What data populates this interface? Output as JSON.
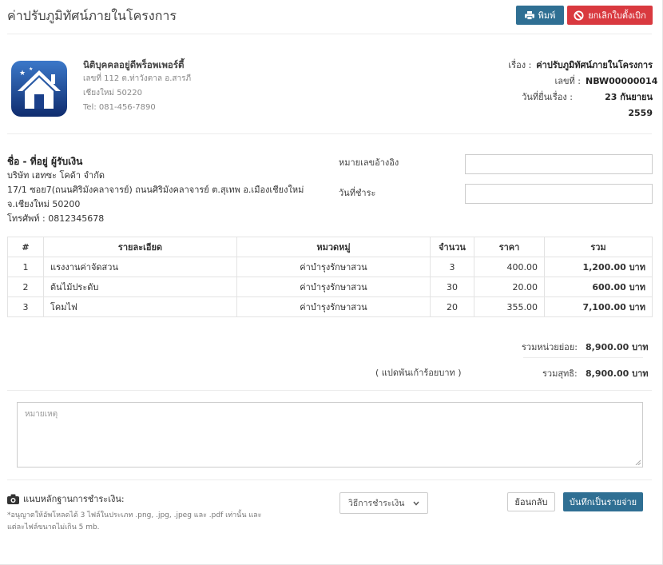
{
  "header": {
    "title": "ค่าปรับภูมิทัศน์ภายในโครงการ",
    "print_label": "พิมพ์",
    "cancel_label": "ยกเลิกใบตั้งเบิก"
  },
  "company": {
    "name": "นิติบุคคลอยู่ดีพร็อพเพอร์ตี้",
    "address1": "เลขที่ 112 ต.ท่าวังตาล อ.สารภี",
    "address2": "เชียงใหม่ 50220",
    "tel": "Tel: 081-456-7890"
  },
  "doc": {
    "subject_label": "เรื่อง :",
    "subject_value": "ค่าปรับภูมิทัศน์ภายในโครงการ",
    "number_label": "เลขที่ :",
    "number_value": "NBW00000014",
    "date_label": "วันที่ยื่นเรื่อง :",
    "date_value": "23 กันยายน 2559"
  },
  "payee": {
    "heading": "ชื่อ - ที่อยู่ ผู้รับเงิน",
    "name": "บริษัท เฮทซะ โคด้า จำกัด",
    "address1": "17/1 ซอย7(ถนนศิริมังคลาจารย์) ถนนศิริมังคลาจารย์ ต.สุเทพ อ.เมืองเชียงใหม่",
    "address2": "จ.เชียงใหม่ 50200",
    "phone": "โทรศัพท์ : 0812345678"
  },
  "fields": {
    "ref_label": "หมายเลขอ้างอิง",
    "ref_value": "",
    "paydate_label": "วันที่ชำระ",
    "paydate_value": ""
  },
  "table": {
    "headers": [
      "#",
      "รายละเอียด",
      "หมวดหมู่",
      "จำนวน",
      "ราคา",
      "รวม"
    ],
    "rows": [
      [
        "1",
        "แรงงานค่าจัดสวน",
        "ค่าบำรุงรักษาสวน",
        "3",
        "400.00",
        "1,200.00 บาท"
      ],
      [
        "2",
        "ต้นไม้ประดับ",
        "ค่าบำรุงรักษาสวน",
        "30",
        "20.00",
        "600.00 บาท"
      ],
      [
        "3",
        "โคมไฟ",
        "ค่าบำรุงรักษาสวน",
        "20",
        "355.00",
        "7,100.00 บาท"
      ]
    ]
  },
  "summary": {
    "subtotal_label": "รวมหน่วยย่อย:",
    "subtotal_value": "8,900.00 บาท",
    "amount_words": "( แปดพันเก้าร้อยบาท )",
    "net_label": "รวมสุทธิ:",
    "net_value": "8,900.00 บาท"
  },
  "notes": {
    "placeholder": "หมายเหตุ"
  },
  "upload": {
    "label": "แนบหลักฐานการชำระเงิน:",
    "note": "*อนุญาตให้อัพโหลดได้ 3 ไฟล์ในประเภท .png, .jpg, .jpeg และ .pdf เท่านั้น และแต่ละไฟล์ขนาดไม่เกิน 5 mb."
  },
  "actions": {
    "payment_method": "วิธีการชำระเงิน",
    "back_label": "ย้อนกลับ",
    "save_label": "บันทึกเป็นรายจ่าย"
  },
  "colors": {
    "primary": "#2f6f93",
    "danger": "#d9393f"
  }
}
